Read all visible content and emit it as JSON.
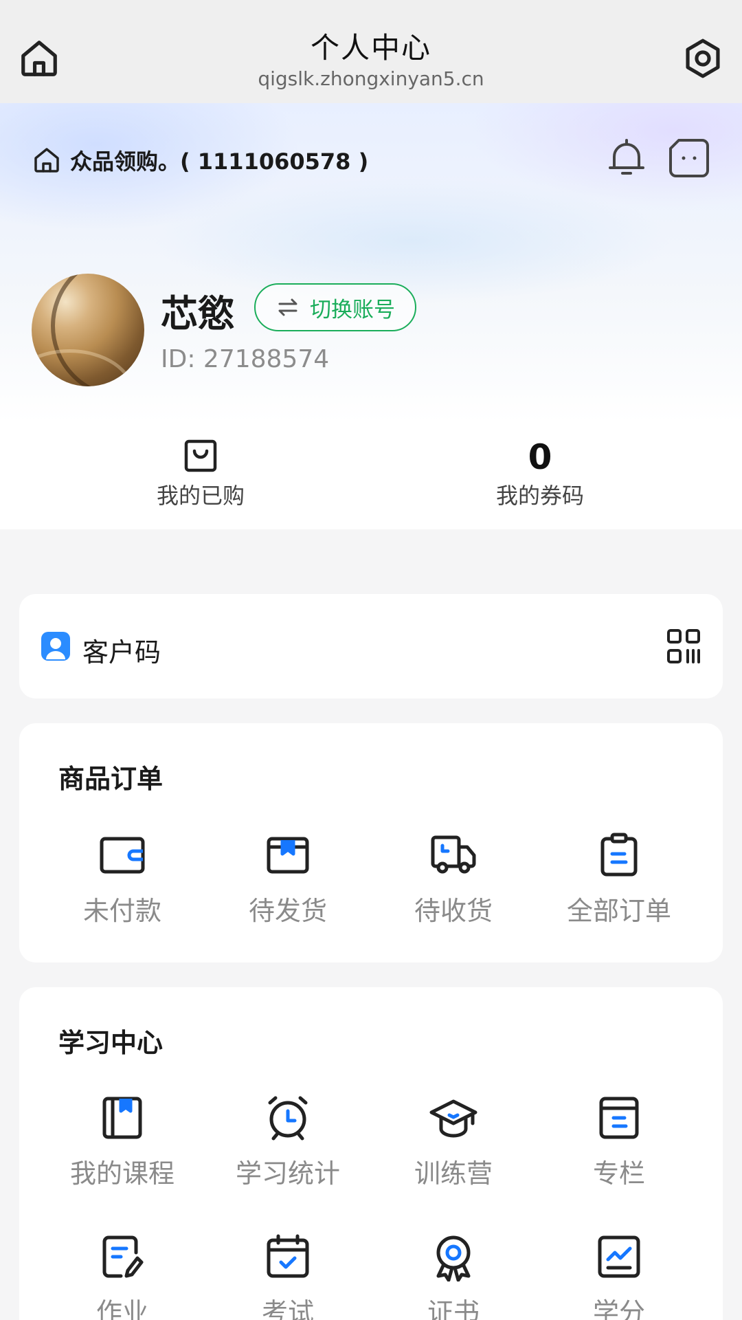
{
  "topbar": {
    "title": "个人中心",
    "url": "qigslk.zhongxinyan5.cn",
    "home_icon": "home-icon",
    "settings_icon": "gear-icon"
  },
  "shop": {
    "name": "众品领购。( 1111060578 )",
    "icon": "home-outline-icon"
  },
  "header_icons": [
    "bell-icon",
    "chat-icon"
  ],
  "profile": {
    "username": "芯慾",
    "switch_label": "切换账号",
    "id_text": "ID: 27188574"
  },
  "stats": {
    "purchased_label": "我的已购",
    "coupons_value": "0",
    "coupons_label": "我的券码"
  },
  "customer_code": {
    "label": "客户码"
  },
  "orders": {
    "title": "商品订单",
    "items": [
      {
        "label": "未付款",
        "icon": "wallet-icon"
      },
      {
        "label": "待发货",
        "icon": "box-icon"
      },
      {
        "label": "待收货",
        "icon": "truck-icon"
      },
      {
        "label": "全部订单",
        "icon": "clipboard-icon"
      }
    ]
  },
  "study": {
    "title": "学习中心",
    "items": [
      {
        "label": "我的课程",
        "icon": "book-icon"
      },
      {
        "label": "学习统计",
        "icon": "alarm-clock-icon"
      },
      {
        "label": "训练营",
        "icon": "graduation-cap-icon"
      },
      {
        "label": "专栏",
        "icon": "column-icon"
      },
      {
        "label": "作业",
        "icon": "homework-icon"
      },
      {
        "label": "考试",
        "icon": "calendar-check-icon"
      },
      {
        "label": "证书",
        "icon": "certificate-icon"
      },
      {
        "label": "学分",
        "icon": "chart-icon"
      }
    ]
  },
  "colors": {
    "accent_green": "#1aad5a",
    "accent_blue": "#1677ff",
    "icon_dark": "#222222"
  }
}
